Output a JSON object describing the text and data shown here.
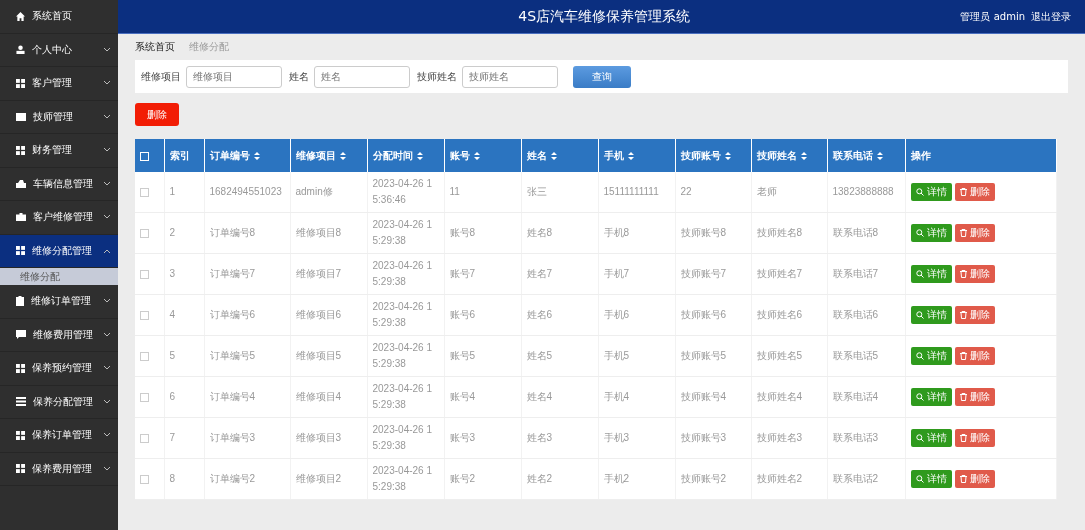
{
  "sidebar": {
    "items": [
      {
        "label": "系统首页",
        "expandable": false,
        "selected": false
      },
      {
        "label": "个人中心",
        "expandable": true,
        "expanded": false,
        "selected": false
      },
      {
        "label": "客户管理",
        "expandable": true,
        "expanded": false,
        "selected": false
      },
      {
        "label": "技师管理",
        "expandable": true,
        "expanded": false,
        "selected": false
      },
      {
        "label": "财务管理",
        "expandable": true,
        "expanded": false,
        "selected": false
      },
      {
        "label": "车辆信息管理",
        "expandable": true,
        "expanded": false,
        "selected": false
      },
      {
        "label": "客户维修管理",
        "expandable": true,
        "expanded": false,
        "selected": false
      },
      {
        "label": "维修分配管理",
        "expandable": true,
        "expanded": true,
        "selected": true,
        "children": [
          {
            "label": "维修分配",
            "selected": true
          }
        ]
      },
      {
        "label": "维修订单管理",
        "expandable": true,
        "expanded": false,
        "selected": false
      },
      {
        "label": "维修费用管理",
        "expandable": true,
        "expanded": false,
        "selected": false
      },
      {
        "label": "保养预约管理",
        "expandable": true,
        "expanded": false,
        "selected": false
      },
      {
        "label": "保养分配管理",
        "expandable": true,
        "expanded": false,
        "selected": false
      },
      {
        "label": "保养订单管理",
        "expandable": true,
        "expanded": false,
        "selected": false
      },
      {
        "label": "保养费用管理",
        "expandable": true,
        "expanded": false,
        "selected": false
      }
    ]
  },
  "header": {
    "title": "4S店汽车维修保养管理系统",
    "user": "管理员 admin",
    "logout": "退出登录"
  },
  "breadcrumb": [
    "系统首页",
    "维修分配"
  ],
  "search": {
    "fields": [
      {
        "label": "维修项目",
        "placeholder": "维修项目"
      },
      {
        "label": "姓名",
        "placeholder": "姓名"
      },
      {
        "label": "技师姓名",
        "placeholder": "技师姓名"
      }
    ],
    "button": "查询"
  },
  "delete_button": "删除",
  "table": {
    "all_checked": false,
    "columns": [
      {
        "label": "索引",
        "sortable": false
      },
      {
        "label": "订单编号",
        "sortable": true
      },
      {
        "label": "维修项目",
        "sortable": true
      },
      {
        "label": "分配时间",
        "sortable": true
      },
      {
        "label": "账号",
        "sortable": true
      },
      {
        "label": "姓名",
        "sortable": true
      },
      {
        "label": "手机",
        "sortable": true
      },
      {
        "label": "技师账号",
        "sortable": true
      },
      {
        "label": "技师姓名",
        "sortable": true
      },
      {
        "label": "联系电话",
        "sortable": true
      },
      {
        "label": "操作",
        "sortable": false
      }
    ],
    "rows": [
      {
        "checked": false,
        "cells": [
          "1",
          "1682494551023",
          "admin修",
          "2023-04-26 15:36:46",
          "11",
          "张三",
          "15111111111",
          "22",
          "老师",
          "13823888888"
        ],
        "actions": [
          "详情",
          "删除"
        ]
      },
      {
        "checked": false,
        "cells": [
          "2",
          "订单编号8",
          "维修项目8",
          "2023-04-26 15:29:38",
          "账号8",
          "姓名8",
          "手机8",
          "技师账号8",
          "技师姓名8",
          "联系电话8"
        ],
        "actions": [
          "详情",
          "删除"
        ]
      },
      {
        "checked": false,
        "cells": [
          "3",
          "订单编号7",
          "维修项目7",
          "2023-04-26 15:29:38",
          "账号7",
          "姓名7",
          "手机7",
          "技师账号7",
          "技师姓名7",
          "联系电话7"
        ],
        "actions": [
          "详情",
          "删除"
        ]
      },
      {
        "checked": false,
        "cells": [
          "4",
          "订单编号6",
          "维修项目6",
          "2023-04-26 15:29:38",
          "账号6",
          "姓名6",
          "手机6",
          "技师账号6",
          "技师姓名6",
          "联系电话6"
        ],
        "actions": [
          "详情",
          "删除"
        ]
      },
      {
        "checked": false,
        "cells": [
          "5",
          "订单编号5",
          "维修项目5",
          "2023-04-26 15:29:38",
          "账号5",
          "姓名5",
          "手机5",
          "技师账号5",
          "技师姓名5",
          "联系电话5"
        ],
        "actions": [
          "详情",
          "删除"
        ]
      },
      {
        "checked": false,
        "cells": [
          "6",
          "订单编号4",
          "维修项目4",
          "2023-04-26 15:29:38",
          "账号4",
          "姓名4",
          "手机4",
          "技师账号4",
          "技师姓名4",
          "联系电话4"
        ],
        "actions": [
          "详情",
          "删除"
        ]
      },
      {
        "checked": false,
        "cells": [
          "7",
          "订单编号3",
          "维修项目3",
          "2023-04-26 15:29:38",
          "账号3",
          "姓名3",
          "手机3",
          "技师账号3",
          "技师姓名3",
          "联系电话3"
        ],
        "actions": [
          "详情",
          "删除"
        ]
      },
      {
        "checked": false,
        "cells": [
          "8",
          "订单编号2",
          "维修项目2",
          "2023-04-26 15:29:38",
          "账号2",
          "姓名2",
          "手机2",
          "技师账号2",
          "技师姓名2",
          "联系电话2"
        ],
        "actions": [
          "详情",
          "删除"
        ]
      }
    ]
  }
}
